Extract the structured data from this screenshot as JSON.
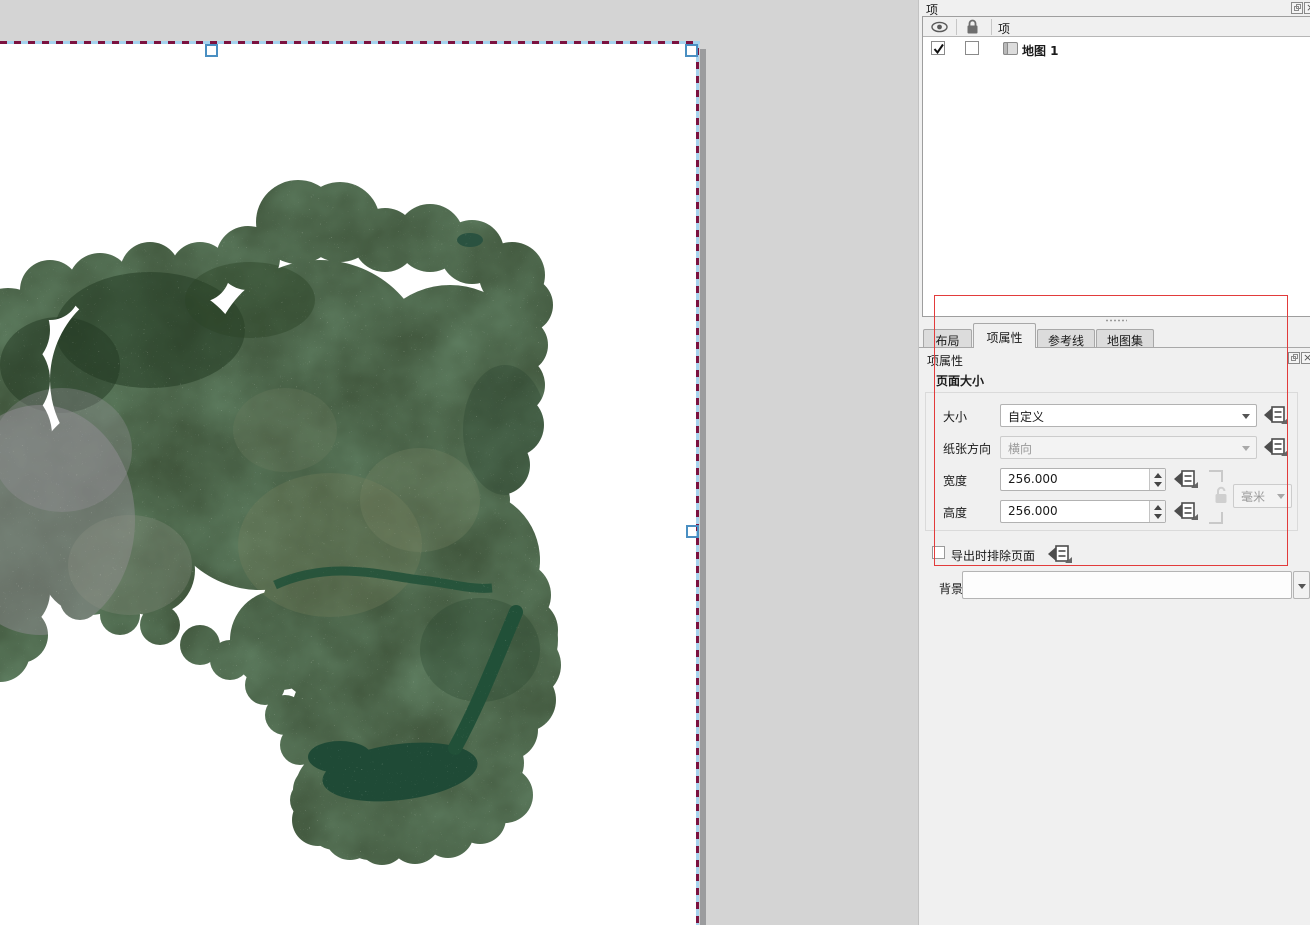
{
  "window": {
    "context": "QGIS print layout"
  },
  "colors": {
    "workspace_gray": "#d4d4d4",
    "page_white": "#ffffff",
    "selection_dash_dark": "#7c1240",
    "selection_dash_light": "#a6d3ee",
    "handle_blue": "#4a8fc2",
    "annotation_red": "#e23b3b",
    "panel_bg": "#f0f0f0"
  },
  "items_panel": {
    "title": "项",
    "column_header": "项",
    "rows": [
      {
        "label": "地图 1",
        "visible": true,
        "locked": false
      }
    ]
  },
  "tabs": [
    {
      "label": "布局"
    },
    {
      "label": "项属性",
      "active": true
    },
    {
      "label": "参考线"
    },
    {
      "label": "地图集"
    }
  ],
  "props": {
    "title": "项属性",
    "section": "页面大小",
    "size_label": "大小",
    "size_value": "自定义",
    "orientation_label": "纸张方向",
    "orientation_value": "横向",
    "width_label": "宽度",
    "width_value": "256.000",
    "height_label": "高度",
    "height_value": "256.000",
    "units_value": "毫米",
    "exclude_label": "导出时排除页面",
    "exclude_checked": false,
    "background_label": "背景"
  }
}
